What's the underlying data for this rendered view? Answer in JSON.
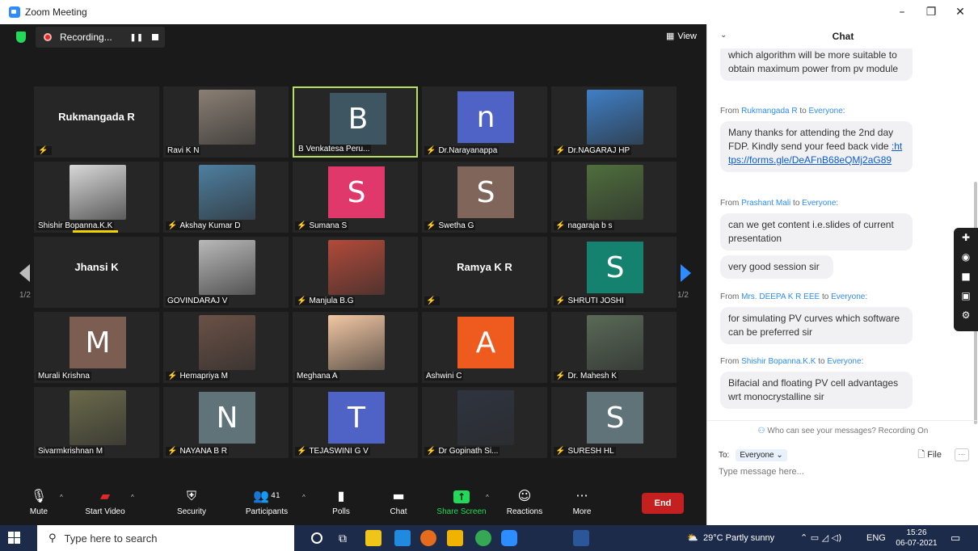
{
  "window": {
    "title": "Zoom Meeting",
    "controls": [
      "–",
      "❐",
      "✕"
    ]
  },
  "meeting": {
    "recording_label": "Recording...",
    "view_label": "View",
    "page_left": "1/2",
    "page_right": "1/2",
    "tiles": [
      {
        "name": "Rukmangada R",
        "kind": "bigname",
        "muted": true
      },
      {
        "name": "Ravi K N",
        "kind": "photo",
        "color": "#8a7f74",
        "muted": false
      },
      {
        "name": "B Venkatesa Peru...",
        "kind": "letter",
        "letter": "B",
        "color": "#3e5661",
        "muted": false,
        "active": true
      },
      {
        "name": "Dr.Narayanappa",
        "kind": "letter",
        "letter": "n",
        "color": "#4f63c6",
        "muted": true
      },
      {
        "name": "Dr.NAGARAJ HP",
        "kind": "photo",
        "color": "#3f7fc6",
        "muted": true
      },
      {
        "name": "Shishir Bopanna.K.K",
        "kind": "photo",
        "color": "#d8d8d8",
        "muted": false,
        "speaking": true
      },
      {
        "name": "Akshay Kumar D",
        "kind": "photo",
        "color": "#4e7fa0",
        "muted": true
      },
      {
        "name": "Sumana S",
        "kind": "letter",
        "letter": "S",
        "color": "#e0386a",
        "muted": true
      },
      {
        "name": "Swetha G",
        "kind": "letter",
        "letter": "S",
        "color": "#80655a",
        "muted": true
      },
      {
        "name": "nagaraja b s",
        "kind": "photo",
        "color": "#4f6e3d",
        "muted": true
      },
      {
        "name": "Jhansi K",
        "kind": "bigname",
        "muted": false
      },
      {
        "name": "GOVINDARAJ V",
        "kind": "photo",
        "color": "#b9b9b9",
        "muted": false
      },
      {
        "name": "Manjula B.G",
        "kind": "photo",
        "color": "#b24a3a",
        "muted": true
      },
      {
        "name": "Ramya K R",
        "kind": "bigname",
        "muted": true
      },
      {
        "name": "SHRUTI JOSHI",
        "kind": "letter",
        "letter": "S",
        "color": "#14826e",
        "muted": true
      },
      {
        "name": "Murali Krishna",
        "kind": "letter",
        "letter": "M",
        "color": "#7c5d51",
        "muted": false
      },
      {
        "name": "Hemapriya M",
        "kind": "photo",
        "color": "#6b5146",
        "muted": true
      },
      {
        "name": "Meghana A",
        "kind": "photo",
        "color": "#f2c7a4",
        "muted": false
      },
      {
        "name": "Ashwini C",
        "kind": "letter",
        "letter": "A",
        "color": "#ef5a1f",
        "muted": false
      },
      {
        "name": "Dr. Mahesh K",
        "kind": "photo",
        "color": "#5a6a58",
        "muted": true
      },
      {
        "name": "Sivarmkrishnan M",
        "kind": "photo",
        "color": "#6b6a4b",
        "muted": false
      },
      {
        "name": "NAYANA B R",
        "kind": "letter",
        "letter": "N",
        "color": "#5f7379",
        "muted": true
      },
      {
        "name": "TEJASWINI G V",
        "kind": "letter",
        "letter": "T",
        "color": "#4f63c6",
        "muted": true
      },
      {
        "name": "Dr Gopinath Si...",
        "kind": "photo",
        "color": "#2e3440",
        "muted": true
      },
      {
        "name": "SURESH HL",
        "kind": "letter",
        "letter": "S",
        "color": "#5f7379",
        "muted": true
      }
    ]
  },
  "toolbar": {
    "mute": "Mute",
    "start_video": "Start Video",
    "security": "Security",
    "participants": "Participants",
    "participants_count": "41",
    "polls": "Polls",
    "chat": "Chat",
    "share_screen": "Share Screen",
    "reactions": "Reactions",
    "more": "More",
    "end": "End"
  },
  "chat": {
    "title": "Chat",
    "partial_message": "which algorithm will be more suitable to obtain maximum power from pv module",
    "messages": [
      {
        "from": "Rukmangada R",
        "to": "Everyone",
        "text": "Many thanks for attending the 2nd day FDP. Kindly send your feed back vide ",
        "link": ":https://forms.gle/DeAFnB68eQMj2aG89"
      },
      {
        "from": "Prashant Mali",
        "to": "Everyone",
        "text": "can we get content i.e.slides of current presentation",
        "text2": "very good session sir"
      },
      {
        "from": "Mrs. DEEPA K R EEE",
        "to": "Everyone",
        "text": "for simulating PV curves which software can be preferred sir"
      },
      {
        "from": "Shishir Bopanna.K.K",
        "to": "Everyone",
        "text": "Bifacial and floating PV cell advantages wrt monocrystalline sir"
      }
    ],
    "from_word": "From",
    "to_word": "to",
    "visibility_note": "Who can see your messages? Recording On",
    "to_label": "To:",
    "to_value": "Everyone",
    "file_label": "File",
    "more_label": "···",
    "input_placeholder": "Type message here..."
  },
  "taskbar": {
    "search_placeholder": "Type here to search",
    "weather": "29°C  Partly sunny",
    "lang": "ENG",
    "time": "15:26",
    "date": "06-07-2021"
  }
}
